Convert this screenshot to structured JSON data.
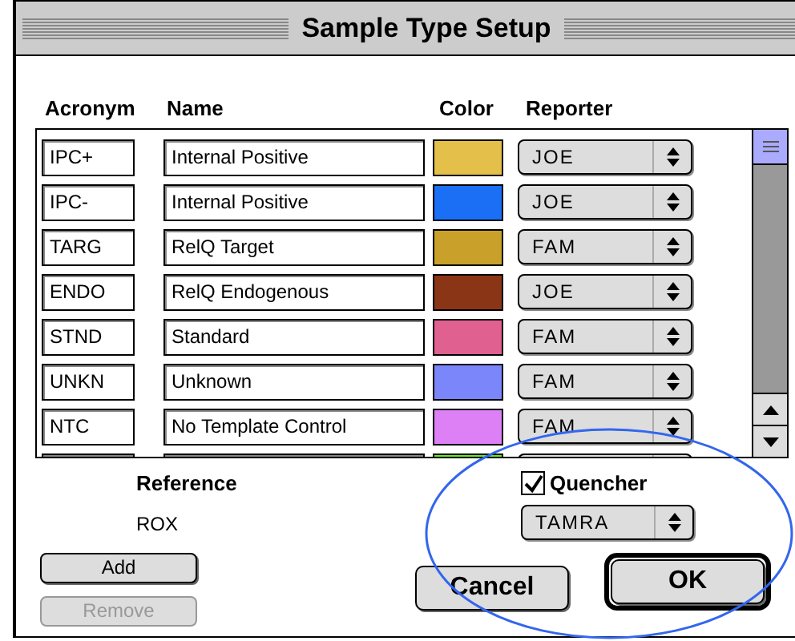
{
  "window": {
    "title": "Sample Type Setup"
  },
  "table": {
    "columns": [
      "Acronym",
      "Name",
      "Color",
      "Reporter"
    ],
    "rows": [
      {
        "acronym": "IPC+",
        "name": "Internal Positive",
        "color": "#e4c04a",
        "reporter": "JOE"
      },
      {
        "acronym": "IPC-",
        "name": "Internal Positive",
        "color": "#1b6ff5",
        "reporter": "JOE"
      },
      {
        "acronym": "TARG",
        "name": "RelQ Target",
        "color": "#c9a02a",
        "reporter": "FAM"
      },
      {
        "acronym": "ENDO",
        "name": "RelQ Endogenous",
        "color": "#8b3517",
        "reporter": "JOE"
      },
      {
        "acronym": "STND",
        "name": "Standard",
        "color": "#e06090",
        "reporter": "FAM"
      },
      {
        "acronym": "UNKN",
        "name": "Unknown",
        "color": "#7b86fa",
        "reporter": "FAM"
      },
      {
        "acronym": "NTC",
        "name": "No Template Control",
        "color": "#dd80f5",
        "reporter": "FAM"
      },
      {
        "color": "#66ee22"
      }
    ]
  },
  "reference": {
    "label": "Reference",
    "value": "ROX"
  },
  "quencher": {
    "label": "Quencher",
    "checked": true,
    "value": "TAMRA"
  },
  "list_buttons": [
    {
      "label": "Add",
      "disabled": false
    },
    {
      "label": "Remove",
      "disabled": true
    }
  ],
  "dialog_buttons": [
    {
      "label": "Cancel",
      "default": false
    },
    {
      "label": "OK",
      "default": true
    }
  ]
}
